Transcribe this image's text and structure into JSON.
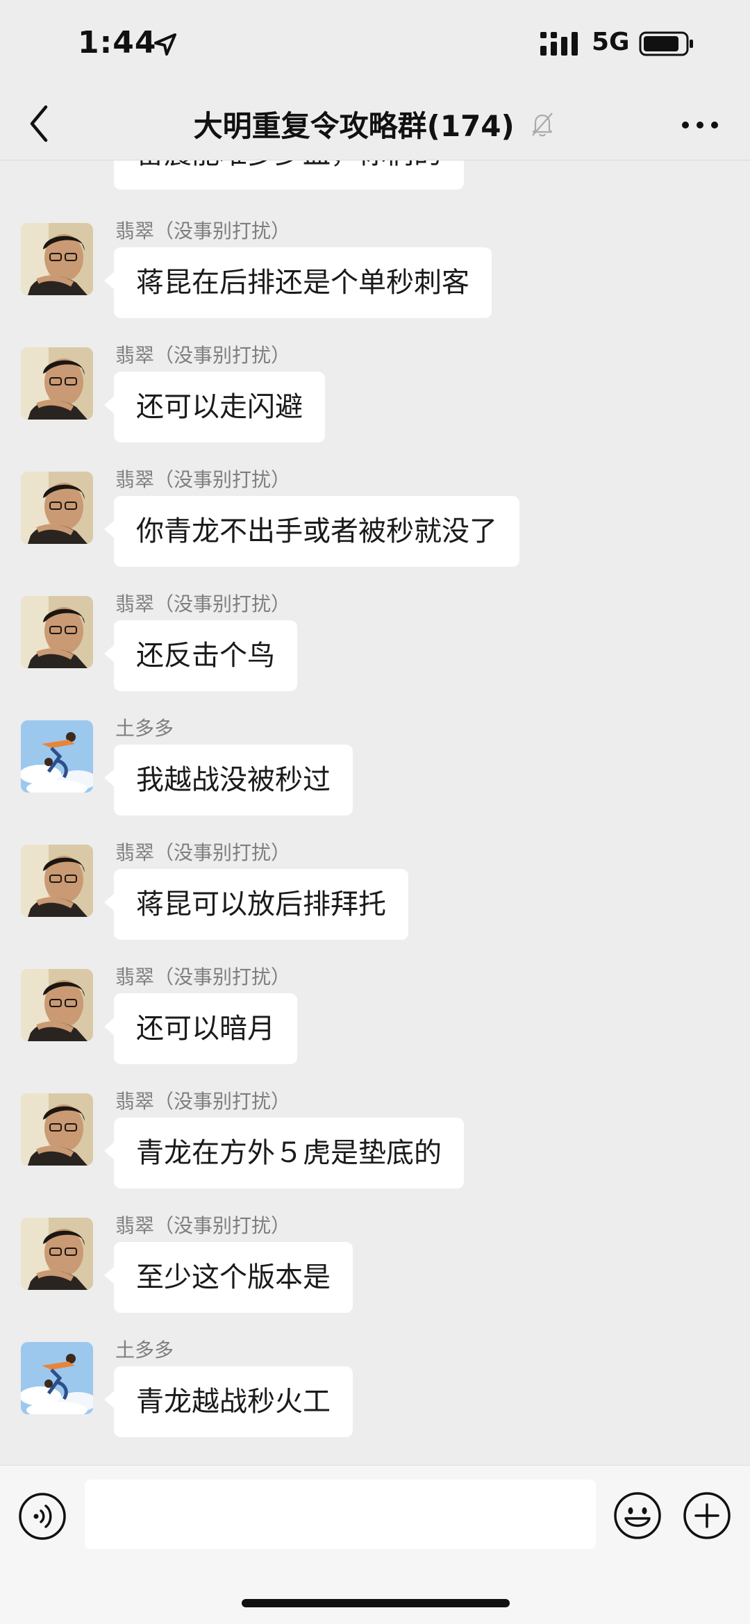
{
  "status": {
    "time": "1:44",
    "network": "5G"
  },
  "nav": {
    "title": "大明重复令攻略群(174)"
  },
  "partial_top_message": "雷震能堆多少血，你们的",
  "messages": [
    {
      "sender": "翡翠（没事别打扰）",
      "text": "蒋昆在后排还是个单秒刺客",
      "avatar": "feicui"
    },
    {
      "sender": "翡翠（没事别打扰）",
      "text": "还可以走闪避",
      "avatar": "feicui"
    },
    {
      "sender": "翡翠（没事别打扰）",
      "text": "你青龙不出手或者被秒就没了",
      "avatar": "feicui"
    },
    {
      "sender": "翡翠（没事别打扰）",
      "text": "还反击个鸟",
      "avatar": "feicui"
    },
    {
      "sender": "土多多",
      "text": "我越战没被秒过",
      "avatar": "tuduoduo"
    },
    {
      "sender": "翡翠（没事别打扰）",
      "text": "蒋昆可以放后排拜托",
      "avatar": "feicui"
    },
    {
      "sender": "翡翠（没事别打扰）",
      "text": "还可以暗月",
      "avatar": "feicui"
    },
    {
      "sender": "翡翠（没事别打扰）",
      "text": "青龙在方外５虎是垫底的",
      "avatar": "feicui"
    },
    {
      "sender": "翡翠（没事别打扰）",
      "text": "至少这个版本是",
      "avatar": "feicui"
    },
    {
      "sender": "土多多",
      "text": "青龙越战秒火工",
      "avatar": "tuduoduo"
    }
  ],
  "input": {
    "value": "",
    "placeholder": ""
  },
  "icons": {
    "back": "chevron-left-icon",
    "mute": "bell-muted-icon",
    "more": "more-dots-icon",
    "voice": "voice-icon",
    "emoji": "emoji-icon",
    "plus": "plus-icon"
  },
  "colors": {
    "background": "#ededed",
    "bubble": "#ffffff",
    "sender": "#7e7e7e"
  }
}
